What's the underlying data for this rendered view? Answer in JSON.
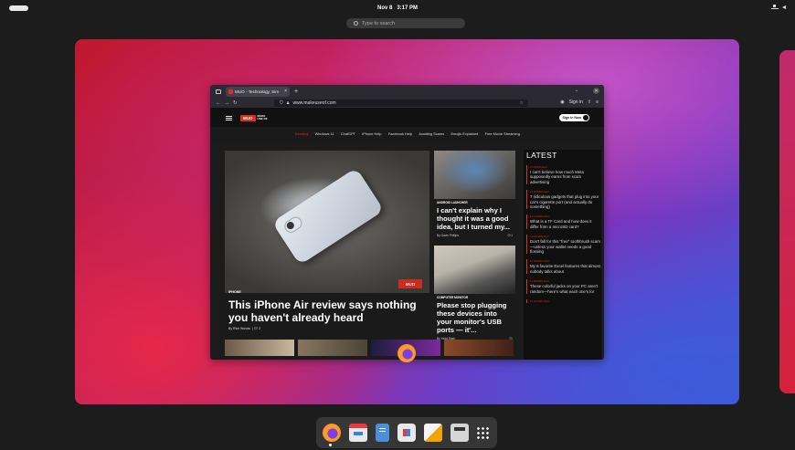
{
  "topbar": {
    "date": "Nov 8",
    "time": "3:17 PM"
  },
  "search": {
    "placeholder": "Type to search"
  },
  "browser": {
    "tab_title": "MUO - Technology, Sim",
    "url": "www.makeuseof.com",
    "signin_label": "Sign in"
  },
  "site": {
    "logo_mark": "MUO",
    "logo_text": "MAKE USE OF",
    "signin_btn": "Sign In Now",
    "trending_label": "Trending",
    "trending": [
      "Windows 11",
      "ChatGPT",
      "iPhone Help",
      "Facebook Help",
      "Avoiding Scams",
      "Emojis Explained",
      "Free Movie Streaming"
    ],
    "hero": {
      "category": "IPHONE",
      "title": "This iPhone Air review says nothing you haven't already heard",
      "byline": "By Rich Woods",
      "comments": "2",
      "watermark": "MUO"
    },
    "side_articles": [
      {
        "category": "ANDROID LAUNCHER",
        "title": "I can't explain why I thought it was a good idea, but I turned my...",
        "byline": "By Gavin Phillips",
        "comments": "1"
      },
      {
        "category": "COMPUTER MONITOR",
        "title": "Please stop plugging these devices into your monitor's USB ports — it'...",
        "byline": "By Yadd Shah",
        "comments": ""
      }
    ],
    "latest_heading": "LATEST",
    "latest": [
      {
        "time": "9 HOURS AGO",
        "text": "I can't believe how much Meta supposedly earns from scam advertising"
      },
      {
        "time": "10 HOURS AGO",
        "text": "7 ridiculous gadgets that plug into your car's cigarette port (and actually do something)"
      },
      {
        "time": "11 HOURS AGO",
        "text": "What is a TF Card and how does it differ from a microSD card?"
      },
      {
        "time": "11 HOURS AGO",
        "text": "Don't fall for this \"free\" toothbrush scam—unless your wallet needs a good flossing"
      },
      {
        "time": "12 HOURS AGO",
        "text": "My 6 favorite Excel features that almost nobody talks about"
      },
      {
        "time": "13 HOURS AGO",
        "text": "These colorful jacks on your PC aren't random—here's what each one's for"
      },
      {
        "time": "14 HOURS AGO",
        "text": ""
      }
    ]
  },
  "dock": [
    "firefox-icon",
    "calendar-icon",
    "files-icon",
    "software-icon",
    "text-editor-icon",
    "calculator-icon",
    "app-grid-icon"
  ]
}
